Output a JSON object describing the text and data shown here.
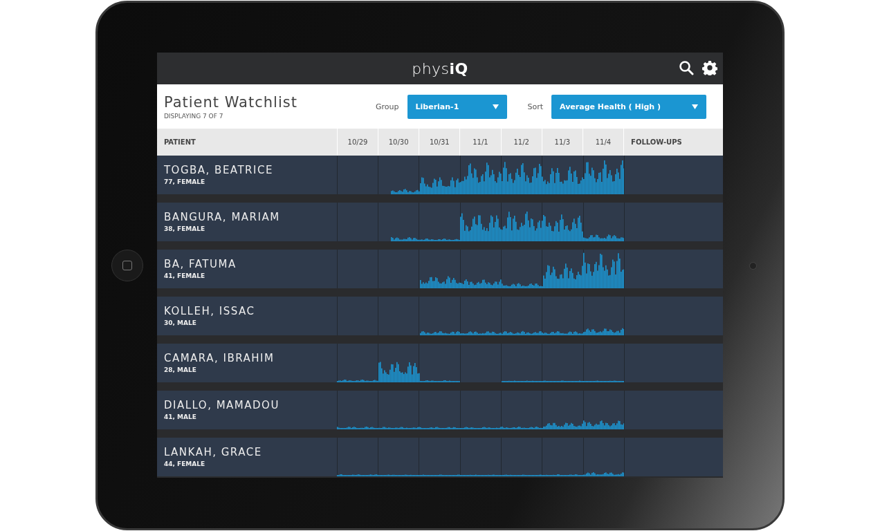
{
  "app": {
    "logo": "phys**iQ**"
  },
  "watchlist": {
    "title": "Patient Watchlist",
    "subtitle": "DISPLAYING 7 OF 7",
    "filters": [
      {
        "label": "Group",
        "value": "Liberian-1"
      },
      {
        "label": "Sort",
        "value": "Average Health ( High )"
      }
    ]
  },
  "table": {
    "columns": [
      "PATIENT",
      "10/29",
      "10/30",
      "10/31",
      "11/1",
      "11/2",
      "11/3",
      "11/4",
      "FOLLOW-UPS"
    ],
    "rows": [
      {
        "name": "TOGBA, BEATRICE",
        "details": "77, FEMALE"
      },
      {
        "name": "BANGURA, MARIAM",
        "details": "38, FEMALE"
      },
      {
        "name": "BA, FATUMA",
        "details": "41, FEMALE"
      },
      {
        "name": "KOLLEH, ISSAC",
        "details": "30, MALE"
      },
      {
        "name": "CAMARA, IBRAHIM",
        "details": "28, MALE"
      },
      {
        "name": "DIALLO, MAMADOU",
        "details": "41, MALE"
      },
      {
        "name": "LANKAH, GRACE",
        "details": "44, FEMALE"
      }
    ]
  }
}
